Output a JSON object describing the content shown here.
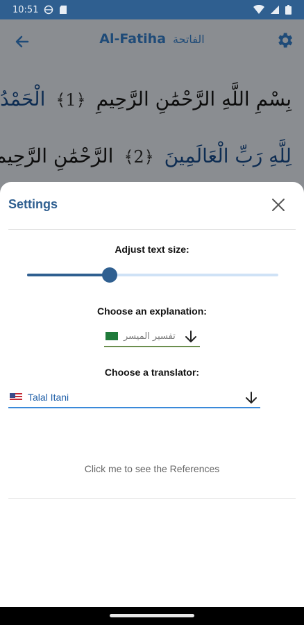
{
  "status_bar": {
    "time": "10:51",
    "left_icons": [
      "vpn-icon",
      "sd-card-icon"
    ],
    "right_icons": [
      "wifi-icon",
      "signal-icon",
      "battery-icon"
    ]
  },
  "app_bar": {
    "title": "Al-Fatiha",
    "title_arabic": "الفاتحة",
    "back_icon": "back-arrow-icon",
    "settings_icon": "gear-icon"
  },
  "quran": {
    "line1": {
      "text": "بِسْمِ اللَّهِ الرَّحْمَٰنِ الرَّحِيمِ",
      "ayah": "1",
      "tail": "الْحَمْدُ"
    },
    "line2": {
      "text": "لِلَّهِ رَبِّ الْعَالَمِينَ",
      "ayah": "2",
      "tail": "الرَّحْمَٰنِ الرَّحِيمِ"
    }
  },
  "settings": {
    "title": "Settings",
    "close_icon": "close-icon",
    "text_size_label": "Adjust text size:",
    "text_size_value": 0.33,
    "explanation_label": "Choose an explanation:",
    "explanation_value": "تفسير الميسر",
    "explanation_flag": "saudi-flag-icon",
    "translator_label": "Choose a translator:",
    "translator_value": "Talal Itani",
    "translator_flag": "us-flag-icon",
    "references_link": "Click me to see the References"
  },
  "colors": {
    "primary": "#2f5f90",
    "accent_blue": "#3a89d9",
    "overlay_gray": "#8a8d91"
  }
}
